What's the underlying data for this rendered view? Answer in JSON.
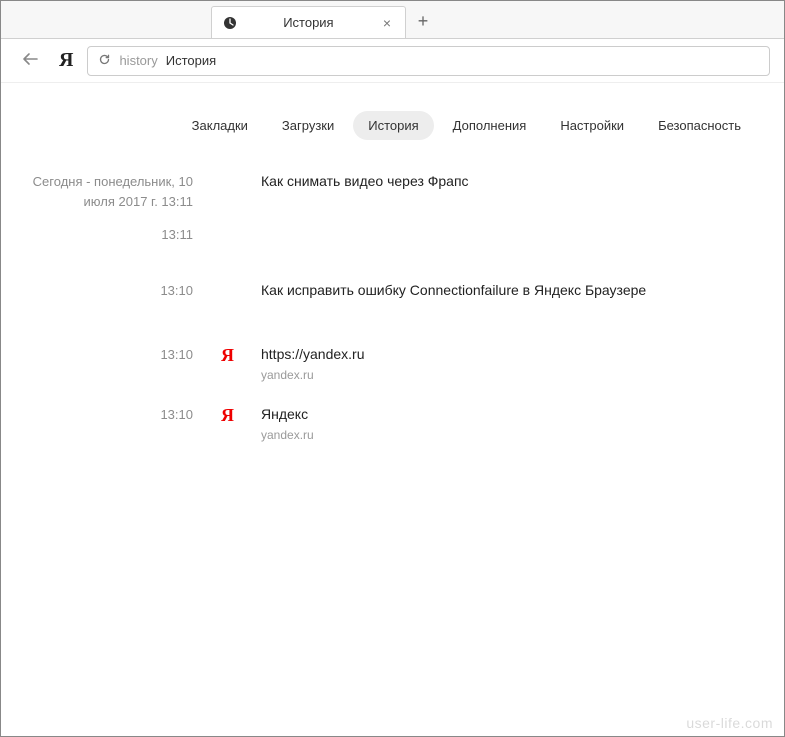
{
  "tab": {
    "title": "История"
  },
  "address": {
    "prefix": "history",
    "title": "История"
  },
  "nav": {
    "items": [
      {
        "label": "Закладки",
        "active": false
      },
      {
        "label": "Загрузки",
        "active": false
      },
      {
        "label": "История",
        "active": true
      },
      {
        "label": "Дополнения",
        "active": false
      },
      {
        "label": "Настройки",
        "active": false
      },
      {
        "label": "Безопасность",
        "active": false
      }
    ]
  },
  "history": {
    "date_label_line1": "Сегодня - понедельник, 10",
    "date_label_line2": "июля 2017 г. 13:11",
    "entries": [
      {
        "time": "",
        "title": "Как снимать видео через Фрапс",
        "url": "",
        "icon": "none"
      },
      {
        "time": "13:11",
        "title": "",
        "url": "",
        "icon": "none"
      },
      {
        "time": "13:10",
        "title": "Как исправить ошибку Connectionfailure в Яндекс Браузере",
        "url": "",
        "icon": "none"
      },
      {
        "time": "13:10",
        "title": "https://yandex.ru",
        "url": "yandex.ru",
        "icon": "yandex"
      },
      {
        "time": "13:10",
        "title": "Яндекс",
        "url": "yandex.ru",
        "icon": "yandex"
      }
    ]
  },
  "watermark": "user-life.com"
}
